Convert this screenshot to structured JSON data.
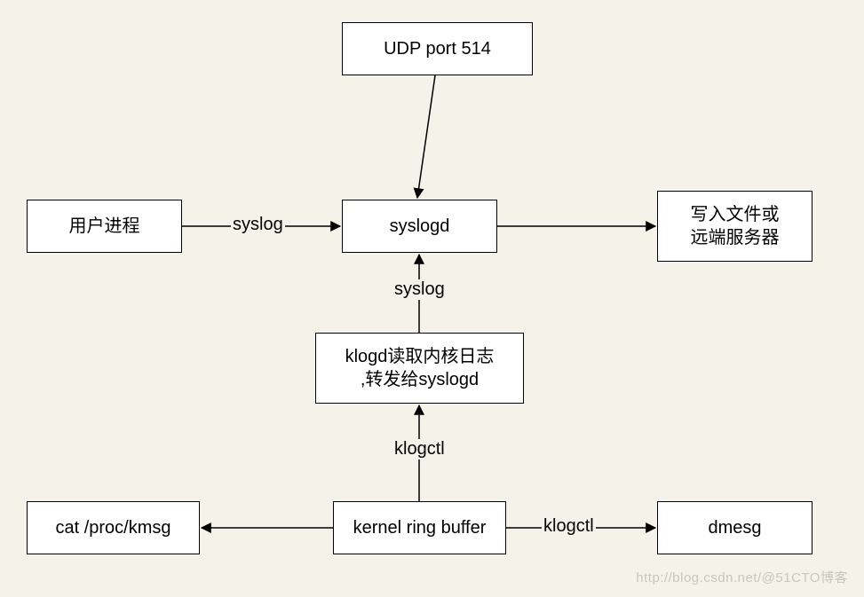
{
  "nodes": {
    "udp": {
      "label": "UDP port 514"
    },
    "user": {
      "label": "用户进程"
    },
    "syslogd": {
      "label": "syslogd"
    },
    "output": {
      "label": "写入文件或\n远端服务器"
    },
    "klogd": {
      "label": "klogd读取内核日志\n,转发给syslogd"
    },
    "krb": {
      "label": "kernel ring buffer"
    },
    "cat": {
      "label": "cat /proc/kmsg"
    },
    "dmesg": {
      "label": "dmesg"
    }
  },
  "edges": {
    "udp_to_syslogd": {
      "label": ""
    },
    "user_to_syslogd": {
      "label": "syslog"
    },
    "syslogd_to_output": {
      "label": ""
    },
    "klogd_to_syslogd": {
      "label": "syslog"
    },
    "krb_to_klogd": {
      "label": "klogctl"
    },
    "krb_to_cat": {
      "label": ""
    },
    "krb_to_dmesg": {
      "label": "klogctl"
    }
  },
  "watermark": "http://blog.csdn.net/@51CTO博客"
}
